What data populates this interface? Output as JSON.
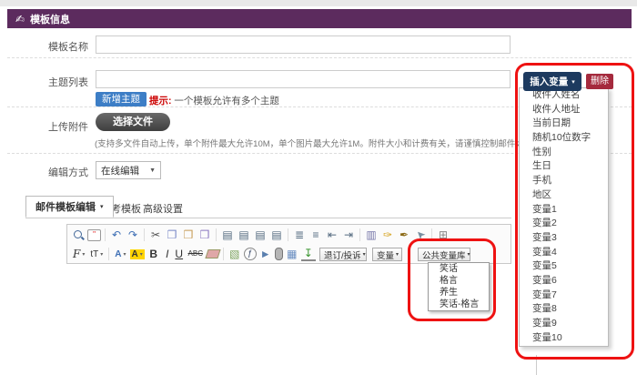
{
  "header": {
    "title": "模板信息"
  },
  "form": {
    "template_name_label": "模板名称",
    "subject_list_label": "主题列表",
    "add_subject_button": "新增主题",
    "subject_hint_label": "提示:",
    "subject_hint_text": " 一个模板允许有多个主题",
    "upload_label": "上传附件",
    "choose_file_button": "选择文件",
    "upload_hint": "(支持多文件自动上传，单个附件最大允许10M，单个图片最大允许1M。附件大小和计费有关，请谨慎控制邮件大小！)",
    "edit_mode_label": "编辑方式",
    "edit_mode_value": "在线编辑"
  },
  "tabs": {
    "tab1": "邮件模板编辑",
    "tab2": "参考模板",
    "tab3": "高级设置"
  },
  "toolbar": {
    "font_label": "F",
    "size_label": "tT",
    "color_label": "A",
    "highlight_label": "A",
    "bold": "B",
    "italic": "I",
    "underline": "U",
    "strike": "ABC",
    "flash_glyph": "ƒ",
    "source_glyph": "\"",
    "unsubscribe_dropdown": "退订/投诉",
    "variable_dropdown": "变量",
    "public_library_dropdown": "公共变量库"
  },
  "public_library_menu": {
    "items": [
      "笑话",
      "格言",
      "养生",
      "笑话-格言"
    ]
  },
  "variable_panel": {
    "insert_button": "插入变量",
    "delete_button": "删除",
    "items": [
      "收件人姓名",
      "收件人地址",
      "当前日期",
      "随机10位数字",
      "性别",
      "生日",
      "手机",
      "地区",
      "变量1",
      "变量2",
      "变量3",
      "变量4",
      "变量5",
      "变量6",
      "变量7",
      "变量8",
      "变量9",
      "变量10"
    ]
  },
  "icons": {
    "header_hand": "✍",
    "undo": "↶",
    "redo": "↷",
    "cut": "✂",
    "copy": "❐",
    "paste": "❒",
    "paste_word": "❒",
    "align": "▤",
    "ordered_list": "≣",
    "unordered_list": "≡",
    "outdent": "⇤",
    "indent": "⇥",
    "blockquote": "▥",
    "fill_color": "✑",
    "brush": "✒",
    "select": "➤",
    "grid": "⊞",
    "image": "▧",
    "video": "►",
    "table": "▦",
    "hr": "↧",
    "link": "∞",
    "unlink": "∞",
    "caret_down": "▾",
    "caret_select": "▼",
    "cross": "✕"
  },
  "colors": {
    "header_purple": "#5c2b5e",
    "button_blue": "#3d7ec6",
    "navy_button": "#1d3a5f",
    "crimson_button": "#a52a3d",
    "annotation_red": "#ee1212",
    "hint_red": "#cc0000"
  }
}
